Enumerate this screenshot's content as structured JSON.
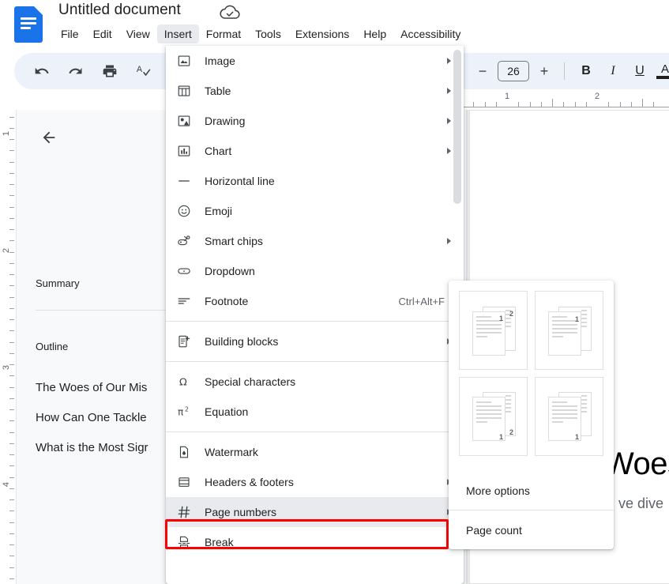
{
  "app": {
    "name": "Google Docs",
    "doc_icon": "google-docs-icon"
  },
  "header": {
    "title": "Untitled document",
    "cloud_status_icon": "cloud-saved-icon",
    "menus": [
      {
        "label": "File",
        "active": false
      },
      {
        "label": "Edit",
        "active": false
      },
      {
        "label": "View",
        "active": false
      },
      {
        "label": "Insert",
        "active": true
      },
      {
        "label": "Format",
        "active": false
      },
      {
        "label": "Tools",
        "active": false
      },
      {
        "label": "Extensions",
        "active": false
      },
      {
        "label": "Help",
        "active": false
      },
      {
        "label": "Accessibility",
        "active": false
      }
    ]
  },
  "toolbar": {
    "left_icons": [
      {
        "name": "undo-icon"
      },
      {
        "name": "redo-icon"
      },
      {
        "name": "print-icon"
      },
      {
        "name": "spelling-check-icon"
      },
      {
        "name": "paint-format-icon"
      }
    ],
    "font_size_decrease": "−",
    "font_size_value": "26",
    "font_size_increase": "+",
    "bold_label": "B",
    "italic_label": "I",
    "underline_label": "U",
    "text_color_label": "A"
  },
  "ruler": {
    "horizontal_numbers": [
      "1",
      "2"
    ],
    "vertical_numbers": [
      "1",
      "2",
      "3",
      "4"
    ]
  },
  "sidebar": {
    "back_icon": "back-arrow-icon",
    "summary_label": "Summary",
    "outline_label": "Outline",
    "outline_items": [
      {
        "label": "The Woes of Our Mis"
      },
      {
        "label": "How Can One Tackle"
      },
      {
        "label": "What is the Most Sigr"
      }
    ]
  },
  "document": {
    "heading_fragment": "Woes",
    "body_fragment": "ve dive"
  },
  "insert_menu": {
    "items": [
      {
        "label": "Image",
        "icon": "image-icon",
        "submenu": true,
        "accel": "",
        "sep_after": false,
        "highlight": false
      },
      {
        "label": "Table",
        "icon": "table-icon",
        "submenu": true,
        "accel": "",
        "sep_after": false,
        "highlight": false
      },
      {
        "label": "Drawing",
        "icon": "drawing-icon",
        "submenu": true,
        "accel": "",
        "sep_after": false,
        "highlight": false
      },
      {
        "label": "Chart",
        "icon": "chart-icon",
        "submenu": true,
        "accel": "",
        "sep_after": false,
        "highlight": false
      },
      {
        "label": "Horizontal line",
        "icon": "horizontal-line-icon",
        "submenu": false,
        "accel": "",
        "sep_after": false,
        "highlight": false
      },
      {
        "label": "Emoji",
        "icon": "emoji-icon",
        "submenu": false,
        "accel": "",
        "sep_after": false,
        "highlight": false
      },
      {
        "label": "Smart chips",
        "icon": "smart-chips-icon",
        "submenu": true,
        "accel": "",
        "sep_after": false,
        "highlight": false
      },
      {
        "label": "Dropdown",
        "icon": "dropdown-icon",
        "submenu": false,
        "accel": "",
        "sep_after": false,
        "highlight": false
      },
      {
        "label": "Footnote",
        "icon": "footnote-icon",
        "submenu": false,
        "accel": "Ctrl+Alt+F",
        "sep_after": true,
        "highlight": false
      },
      {
        "label": "Building blocks",
        "icon": "building-blocks-icon",
        "submenu": true,
        "accel": "",
        "sep_after": true,
        "highlight": false
      },
      {
        "label": "Special characters",
        "icon": "special-characters-icon",
        "submenu": false,
        "accel": "",
        "sep_after": false,
        "highlight": false
      },
      {
        "label": "Equation",
        "icon": "equation-icon",
        "submenu": false,
        "accel": "",
        "sep_after": true,
        "highlight": false
      },
      {
        "label": "Watermark",
        "icon": "watermark-icon",
        "submenu": false,
        "accel": "",
        "sep_after": false,
        "highlight": false
      },
      {
        "label": "Headers & footers",
        "icon": "headers-footers-icon",
        "submenu": true,
        "accel": "",
        "sep_after": false,
        "highlight": false
      },
      {
        "label": "Page numbers",
        "icon": "page-numbers-icon",
        "submenu": true,
        "accel": "",
        "sep_after": false,
        "highlight": true
      },
      {
        "label": "Break",
        "icon": "break-icon",
        "submenu": true,
        "accel": "",
        "sep_after": false,
        "highlight": false
      }
    ]
  },
  "page_numbers_submenu": {
    "thumbnails": [
      {
        "name": "page-number-top-right-all-pages",
        "position": "top-right",
        "numbers": [
          "1",
          "2"
        ]
      },
      {
        "name": "page-number-top-right-skip-first",
        "position": "top-right",
        "numbers": [
          "1"
        ]
      },
      {
        "name": "page-number-bottom-right-all-pages",
        "position": "bottom-right",
        "numbers": [
          "1",
          "2"
        ]
      },
      {
        "name": "page-number-bottom-right-skip-first",
        "position": "bottom-right",
        "numbers": [
          "1"
        ]
      }
    ],
    "more_options_label": "More options",
    "page_count_label": "Page count"
  },
  "colors": {
    "brand_blue": "#1a73e8",
    "toolbar_bg": "#edf2fa",
    "sidebar_bg": "#f8f9fa",
    "menu_highlight": "#e8eaed",
    "annotation_red": "#ff0000",
    "text_primary": "#202124",
    "text_secondary": "#5f6368"
  }
}
